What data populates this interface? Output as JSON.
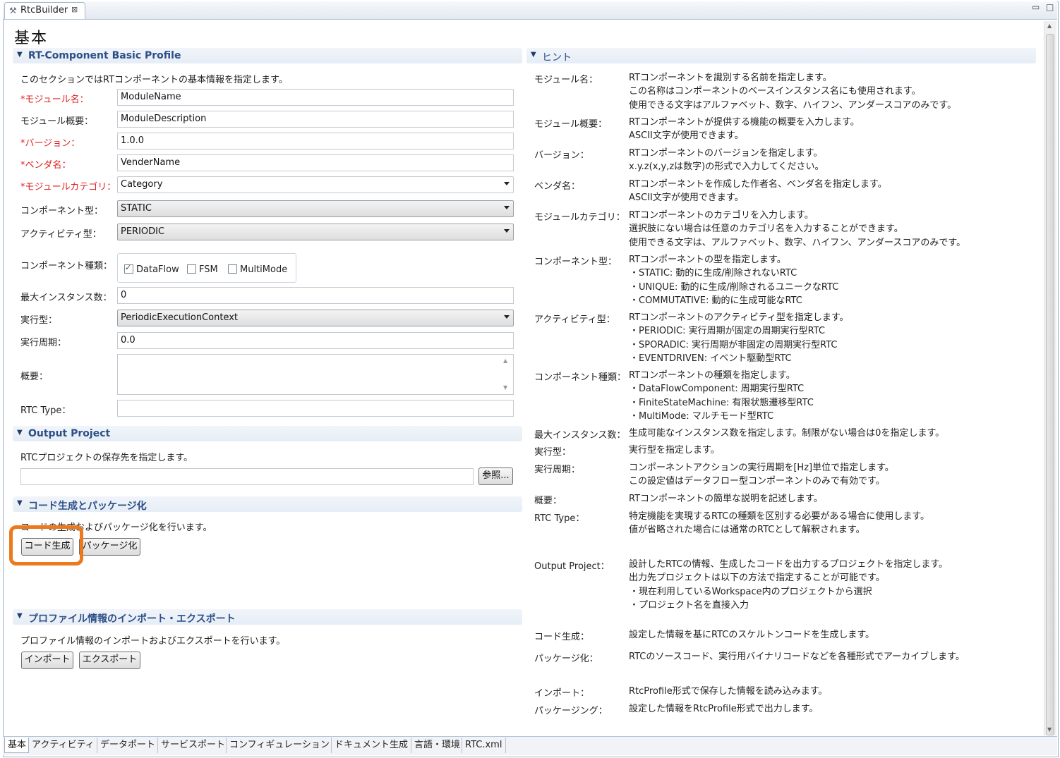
{
  "window": {
    "tab_title": "RtcBuilder",
    "tab_close": "⊠",
    "minimize": "▭",
    "maximize": "□"
  },
  "page_title": "基本",
  "basic_profile": {
    "title": "RT-Component Basic Profile",
    "description": "このセクションではRTコンポーネントの基本情報を指定します。",
    "fields": {
      "module_name": {
        "label": "*モジュール名：",
        "value": "ModuleName"
      },
      "module_desc": {
        "label": "モジュール概要：",
        "value": "ModuleDescription"
      },
      "version": {
        "label": "*バージョン：",
        "value": "1.0.0"
      },
      "vendor": {
        "label": "*ベンダ名：",
        "value": "VenderName"
      },
      "category": {
        "label": "*モジュールカテゴリ：",
        "value": "Category"
      },
      "component_type": {
        "label": "コンポーネント型：",
        "value": "STATIC"
      },
      "activity_type": {
        "label": "アクティビティ型：",
        "value": "PERIODIC"
      },
      "component_kind": {
        "label": "コンポーネント種類：",
        "options": [
          "DataFlow",
          "FSM",
          "MultiMode"
        ]
      },
      "max_instance": {
        "label": "最大インスタンス数：",
        "value": "0"
      },
      "exec_type": {
        "label": "実行型：",
        "value": "PeriodicExecutionContext"
      },
      "exec_rate": {
        "label": "実行周期：",
        "value": "0.0"
      },
      "abstract": {
        "label": "概要：",
        "value": ""
      },
      "rtc_type": {
        "label": "RTC Type：",
        "value": ""
      }
    }
  },
  "output_project": {
    "title": "Output Project",
    "description": "RTCプロジェクトの保存先を指定します。",
    "path_value": "",
    "browse_label": "参照..."
  },
  "codegen": {
    "title": "コード生成とパッケージ化",
    "description": "コードの生成およびパッケージ化を行います。",
    "generate_label": "コード生成",
    "package_label": "パッケージ化"
  },
  "profile_io": {
    "title": "プロファイル情報のインポート・エクスポート",
    "description": "プロファイル情報のインポートおよびエクスポートを行います。",
    "import_label": "インポート",
    "export_label": "エクスポート"
  },
  "hint": {
    "title": "ヒント",
    "items": [
      {
        "label": "モジュール名：",
        "lines": [
          "RTコンポーネントを識別する名前を指定します。",
          "この名称はコンポーネントのベースインスタンス名にも使用されます。",
          "使用できる文字はアルファベット、数字、ハイフン、アンダースコアのみです。"
        ]
      },
      {
        "label": "モジュール概要：",
        "lines": [
          "RTコンポーネントが提供する機能の概要を入力します。",
          "ASCII文字が使用できます。"
        ]
      },
      {
        "label": "バージョン：",
        "lines": [
          "RTコンポーネントのバージョンを指定します。",
          "x.y.z(x,y,zは数字)の形式で入力してください。"
        ]
      },
      {
        "label": "ベンダ名：",
        "lines": [
          "RTコンポーネントを作成した作者名、ベンダ名を指定します。",
          "ASCII文字が使用できます。"
        ]
      },
      {
        "label": "モジュールカテゴリ：",
        "lines": [
          "RTコンポーネントのカテゴリを入力します。",
          "選択肢にない場合は任意のカテゴリ名を入力することができます。",
          "使用できる文字は、アルファベット、数字、ハイフン、アンダースコアのみです。"
        ]
      },
      {
        "label": "コンポーネント型：",
        "lines": [
          "RTコンポーネントの型を指定します。",
          "・STATIC: 動的に生成/削除されないRTC",
          "・UNIQUE: 動的に生成/削除されるユニークなRTC",
          "・COMMUTATIVE: 動的に生成可能なRTC"
        ]
      },
      {
        "label": "アクティビティ型：",
        "lines": [
          "RTコンポーネントのアクティビティ型を指定します。",
          "・PERIODIC: 実行周期が固定の周期実行型RTC",
          "・SPORADIC: 実行周期が非固定の周期実行型RTC",
          "・EVENTDRIVEN: イベント駆動型RTC"
        ]
      },
      {
        "label": "コンポーネント種類：",
        "lines": [
          "RTコンポーネントの種類を指定します。",
          "・DataFlowComponent: 周期実行型RTC",
          "・FiniteStateMachine: 有限状態遷移型RTC",
          "・MultiMode: マルチモード型RTC"
        ]
      },
      {
        "label": "最大インスタンス数：",
        "lines": [
          "生成可能なインスタンス数を指定します。制限がない場合は0を指定します。"
        ]
      },
      {
        "label": "実行型：",
        "lines": [
          "実行型を指定します。"
        ]
      },
      {
        "label": "実行周期：",
        "lines": [
          "コンポーネントアクションの実行周期を[Hz]単位で指定します。",
          "この設定値はデータフロー型コンポーネントのみで有効です。"
        ]
      },
      {
        "label": "概要：",
        "lines": [
          "RTコンポーネントの簡単な説明を記述します。"
        ]
      },
      {
        "label": "RTC Type：",
        "lines": [
          "特定機能を実現するRTCの種類を区別する必要がある場合に使用します。",
          "値が省略された場合には通常のRTCとして解釈されます。"
        ]
      },
      {
        "label": "Output Project：",
        "lines": [
          "設計したRTCの情報、生成したコードを出力するプロジェクトを指定します。",
          "出力先プロジェクトは以下の方法で指定することが可能です。",
          "・現在利用しているWorkspace内のプロジェクトから選択",
          "・プロジェクト名を直接入力"
        ]
      },
      {
        "label": "コード生成：",
        "lines": [
          "設定した情報を基にRTCのスケルトンコードを生成します。"
        ]
      },
      {
        "label": "パッケージ化：",
        "lines": [
          "RTCのソースコード、実行用バイナリコードなどを各種形式でアーカイブします。"
        ]
      },
      {
        "label": "インポート：",
        "lines": [
          "RtcProfile形式で保存した情報を読み込みます。"
        ]
      },
      {
        "label": "パッケージング：",
        "lines": [
          "設定した情報をRtcProfile形式で出力します。"
        ]
      }
    ]
  },
  "bottom_tabs": [
    "基本",
    "アクティビティ",
    "データポート",
    "サービスポート",
    "コンフィギュレーション",
    "ドキュメント生成",
    "言語・環境",
    "RTC.xml"
  ],
  "colors": {
    "required": "#e02020",
    "section_title": "#2c4f86",
    "highlight": "#ec7a1c"
  }
}
